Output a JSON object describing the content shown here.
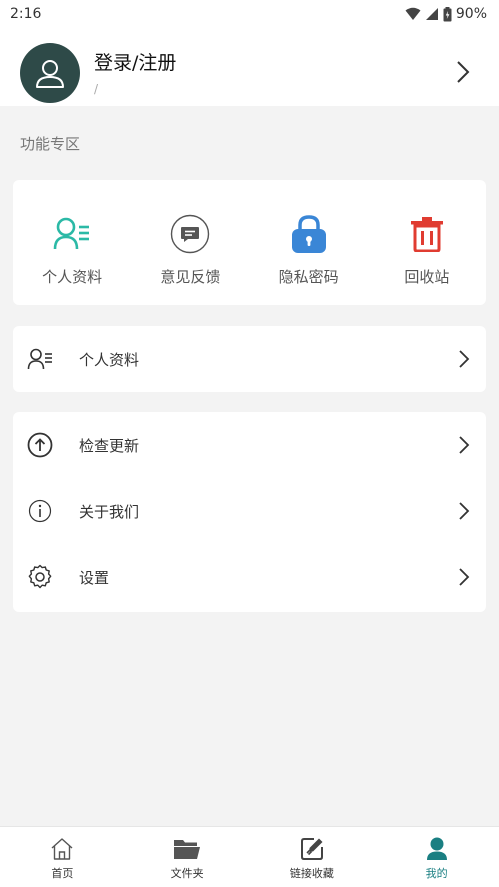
{
  "status_bar": {
    "time": "2:16",
    "battery": "90%"
  },
  "profile": {
    "login_label": "登录/注册",
    "subtitle": "/"
  },
  "section_title": "功能专区",
  "quick_actions": [
    {
      "label": "个人资料",
      "icon": "profile-icon",
      "color": "#2bb9a6"
    },
    {
      "label": "意见反馈",
      "icon": "feedback-icon",
      "color": "#555555"
    },
    {
      "label": "隐私密码",
      "icon": "lock-icon",
      "color": "#3a86d6"
    },
    {
      "label": "回收站",
      "icon": "trash-icon",
      "color": "#e03c31"
    }
  ],
  "menu_group_1": [
    {
      "label": "个人资料",
      "icon": "profile-icon"
    }
  ],
  "menu_group_2": [
    {
      "label": "检查更新",
      "icon": "upload-circle-icon"
    },
    {
      "label": "关于我们",
      "icon": "info-icon"
    },
    {
      "label": "设置",
      "icon": "gear-icon"
    }
  ],
  "tabbar": {
    "items": [
      {
        "label": "首页",
        "icon": "home-icon"
      },
      {
        "label": "文件夹",
        "icon": "folder-icon"
      },
      {
        "label": "链接收藏",
        "icon": "link-edit-icon"
      },
      {
        "label": "我的",
        "icon": "user-icon"
      }
    ],
    "active_index": 3,
    "active_color": "#1a7f82"
  }
}
